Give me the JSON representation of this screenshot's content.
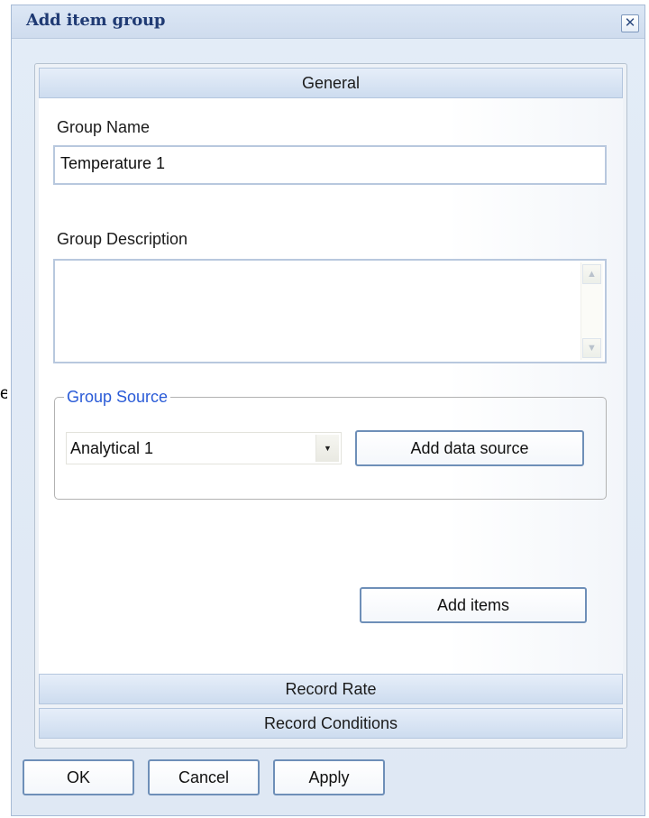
{
  "background_text": {
    "partial_char": "e"
  },
  "dialog": {
    "title": "Add item group",
    "close_glyph": "✕"
  },
  "sections": {
    "general": "General",
    "record_rate": "Record Rate",
    "record_conditions": "Record Conditions"
  },
  "form": {
    "group_name_label": "Group Name",
    "group_name_value": "Temperature 1",
    "group_description_label": "Group Description",
    "group_description_value": "",
    "group_source": {
      "legend": "Group Source",
      "selected_source": "Analytical 1",
      "add_data_source_label": "Add data source"
    },
    "add_items_label": "Add items"
  },
  "footer": {
    "ok_label": "OK",
    "cancel_label": "Cancel",
    "apply_label": "Apply"
  },
  "colors": {
    "title_text": "#1f3a73",
    "legend_text": "#2a5bd7",
    "button_border": "#6e8fb8",
    "section_header_top": "#e6eef9",
    "section_header_bottom": "#cddcef"
  },
  "icons": {
    "close": "close-icon",
    "dropdown": "chevron-down-icon",
    "scroll_up": "scroll-up-arrow-icon",
    "scroll_down": "scroll-down-arrow-icon"
  }
}
